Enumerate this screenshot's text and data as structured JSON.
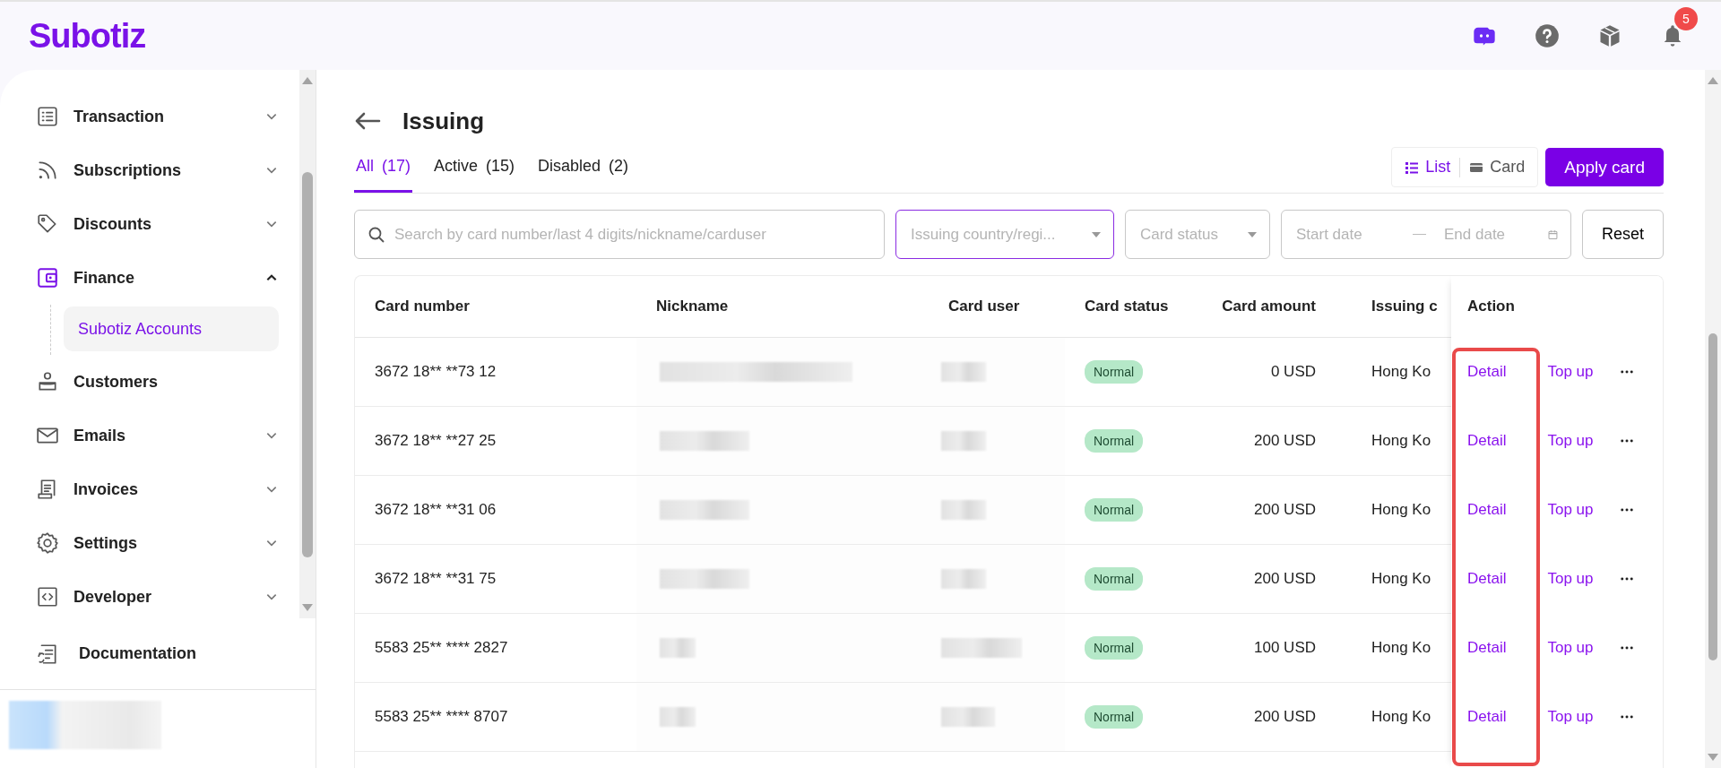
{
  "header": {
    "logo": "Subotiz",
    "notifications": "5"
  },
  "sidebar": {
    "items": [
      {
        "label": "Transaction",
        "kind": "group",
        "expanded": false,
        "selected": false
      },
      {
        "label": "Subscriptions",
        "kind": "group",
        "expanded": false,
        "selected": false
      },
      {
        "label": "Discounts",
        "kind": "group",
        "expanded": false,
        "selected": false
      },
      {
        "label": "Finance",
        "kind": "group",
        "expanded": true,
        "selected": true,
        "children": [
          {
            "label": "Subotiz Accounts",
            "selected": true
          }
        ]
      },
      {
        "label": "Customers",
        "kind": "link",
        "selected": false
      },
      {
        "label": "Emails",
        "kind": "group",
        "expanded": false,
        "selected": false
      },
      {
        "label": "Invoices",
        "kind": "group",
        "expanded": false,
        "selected": false
      },
      {
        "label": "Settings",
        "kind": "group",
        "expanded": false,
        "selected": false
      },
      {
        "label": "Developer",
        "kind": "group",
        "expanded": false,
        "selected": false
      }
    ],
    "footer_item": {
      "label": "Documentation"
    }
  },
  "page": {
    "title": "Issuing",
    "tabs": [
      {
        "label": "All",
        "count": "(17)",
        "selected": true
      },
      {
        "label": "Active",
        "count": "(15)",
        "selected": false
      },
      {
        "label": "Disabled",
        "count": "(2)",
        "selected": false
      }
    ],
    "views": [
      {
        "label": "List",
        "selected": true
      },
      {
        "label": "Card",
        "selected": false
      }
    ],
    "apply_button": "Apply card",
    "filters": {
      "search": {
        "placeholder": "Search by card number/last 4 digits/nickname/carduser"
      },
      "country": {
        "placeholder": "Issuing country/regi...",
        "focused": true
      },
      "status": {
        "placeholder": "Card status"
      },
      "start_date": {
        "placeholder": "Start date"
      },
      "end_date": {
        "placeholder": "End date"
      },
      "reset": "Reset"
    },
    "table": {
      "columns": [
        "Card number",
        "Nickname",
        "Card user",
        "Card status",
        "Card amount",
        "Issuing c",
        "Action"
      ],
      "rows": [
        {
          "card_number": "3672 18** **73 12",
          "status": "Normal",
          "amount": "0 USD",
          "country": "Hong Ko",
          "actions": [
            "Detail",
            "Top up"
          ]
        },
        {
          "card_number": "3672 18** **27 25",
          "status": "Normal",
          "amount": "200 USD",
          "country": "Hong Ko",
          "actions": [
            "Detail",
            "Top up"
          ]
        },
        {
          "card_number": "3672 18** **31 06",
          "status": "Normal",
          "amount": "200 USD",
          "country": "Hong Ko",
          "actions": [
            "Detail",
            "Top up"
          ]
        },
        {
          "card_number": "3672 18** **31 75",
          "status": "Normal",
          "amount": "200 USD",
          "country": "Hong Ko",
          "actions": [
            "Detail",
            "Top up"
          ]
        },
        {
          "card_number": "5583 25** **** 2827",
          "status": "Normal",
          "amount": "100 USD",
          "country": "Hong Ko",
          "actions": [
            "Detail",
            "Top up"
          ]
        },
        {
          "card_number": "5583 25** **** 8707",
          "status": "Normal",
          "amount": "200 USD",
          "country": "Hong Ko",
          "actions": [
            "Detail",
            "Top up"
          ]
        }
      ]
    }
  }
}
